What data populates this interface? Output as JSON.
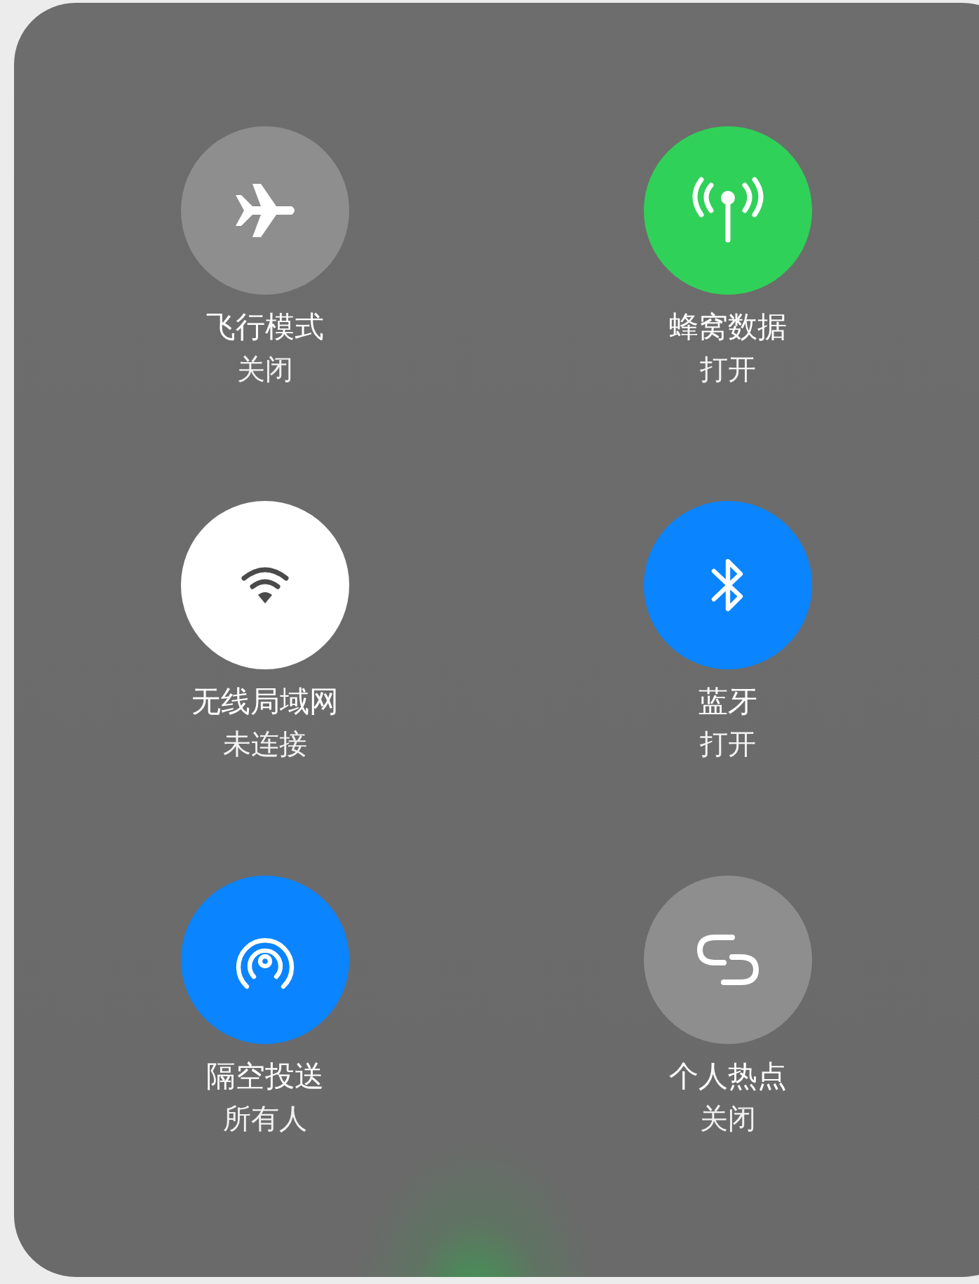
{
  "toggles": [
    {
      "kind": "airplane",
      "label": "飞行模式",
      "status": "关闭",
      "color": "#8e8e8e"
    },
    {
      "kind": "cellular",
      "label": "蜂窝数据",
      "status": "打开",
      "color": "#30d158"
    },
    {
      "kind": "wifi",
      "label": "无线局域网",
      "status": "未连接",
      "color": "#ffffff"
    },
    {
      "kind": "bluetooth",
      "label": "蓝牙",
      "status": "打开",
      "color": "#0a84ff"
    },
    {
      "kind": "airdrop",
      "label": "隔空投送",
      "status": "所有人",
      "color": "#0a84ff"
    },
    {
      "kind": "hotspot",
      "label": "个人热点",
      "status": "关闭",
      "color": "#8e8e8e"
    }
  ]
}
